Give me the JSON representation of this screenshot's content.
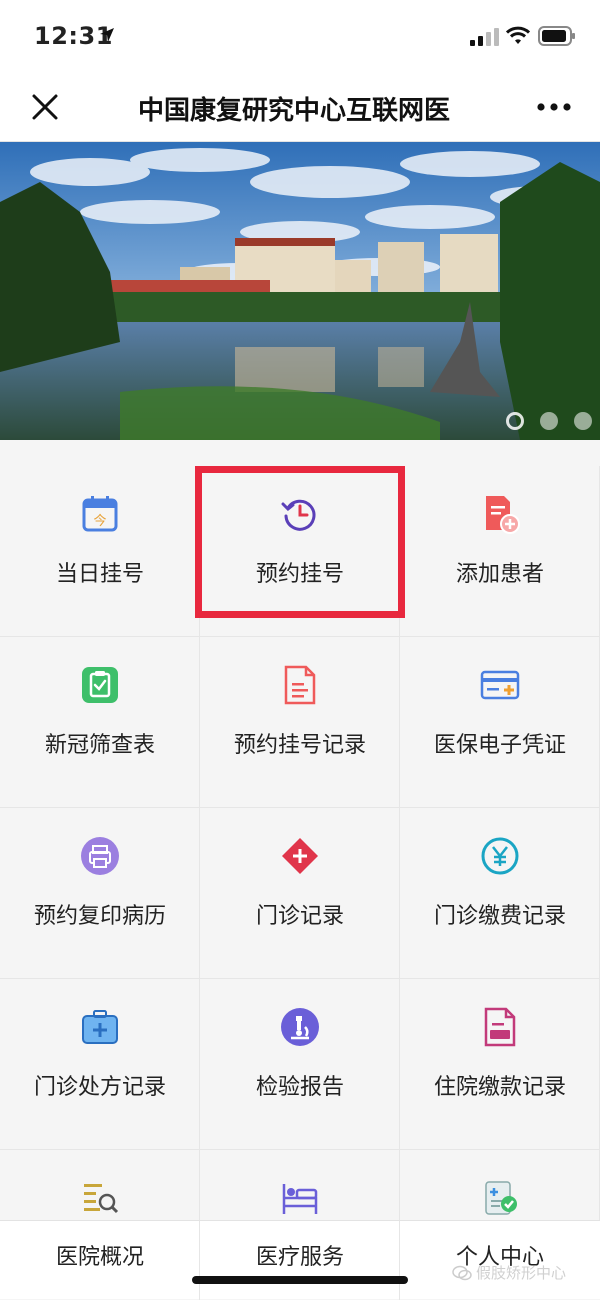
{
  "status_bar": {
    "time": "12:31"
  },
  "navbar": {
    "title": "中国康复研究中心互联网医"
  },
  "banner": {
    "dots_total": 3,
    "active_dot": 1
  },
  "grid": {
    "items": [
      {
        "label": "当日挂号",
        "icon": "calendar-today-icon",
        "color": "#4a7fe0"
      },
      {
        "label": "预约挂号",
        "icon": "clock-history-icon",
        "color": "#5a3fb8"
      },
      {
        "label": "添加患者",
        "icon": "add-document-icon",
        "color": "#ef5a5a"
      },
      {
        "label": "新冠筛查表",
        "icon": "clipboard-check-icon",
        "color": "#3ebf6a"
      },
      {
        "label": "预约挂号记录",
        "icon": "document-list-icon",
        "color": "#ef5a5a"
      },
      {
        "label": "医保电子凭证",
        "icon": "card-icon",
        "color": "#4a7fe0"
      },
      {
        "label": "预约复印病历",
        "icon": "printer-icon",
        "color": "#9b7fe0"
      },
      {
        "label": "门诊记录",
        "icon": "medical-cross-icon",
        "color": "#e0354a"
      },
      {
        "label": "门诊缴费记录",
        "icon": "yuan-circle-icon",
        "color": "#1aa5c4"
      },
      {
        "label": "门诊处方记录",
        "icon": "medical-case-icon",
        "color": "#3a8fe0"
      },
      {
        "label": "检验报告",
        "icon": "microscope-icon",
        "color": "#6a5fd8"
      },
      {
        "label": "住院缴款记录",
        "icon": "invoice-icon",
        "color": "#c23a7a"
      },
      {
        "label": "",
        "icon": "list-search-icon",
        "color": "#c8a63a"
      },
      {
        "label": "",
        "icon": "hospital-bed-icon",
        "color": "#6a5fd8"
      },
      {
        "label": "",
        "icon": "report-check-icon",
        "color": "#3ebf6a"
      }
    ]
  },
  "tabbar": {
    "tabs": [
      {
        "label": "医院概况"
      },
      {
        "label": "医疗服务"
      },
      {
        "label": "个人中心"
      }
    ]
  },
  "watermark": {
    "text": "假肢矫形中心"
  }
}
